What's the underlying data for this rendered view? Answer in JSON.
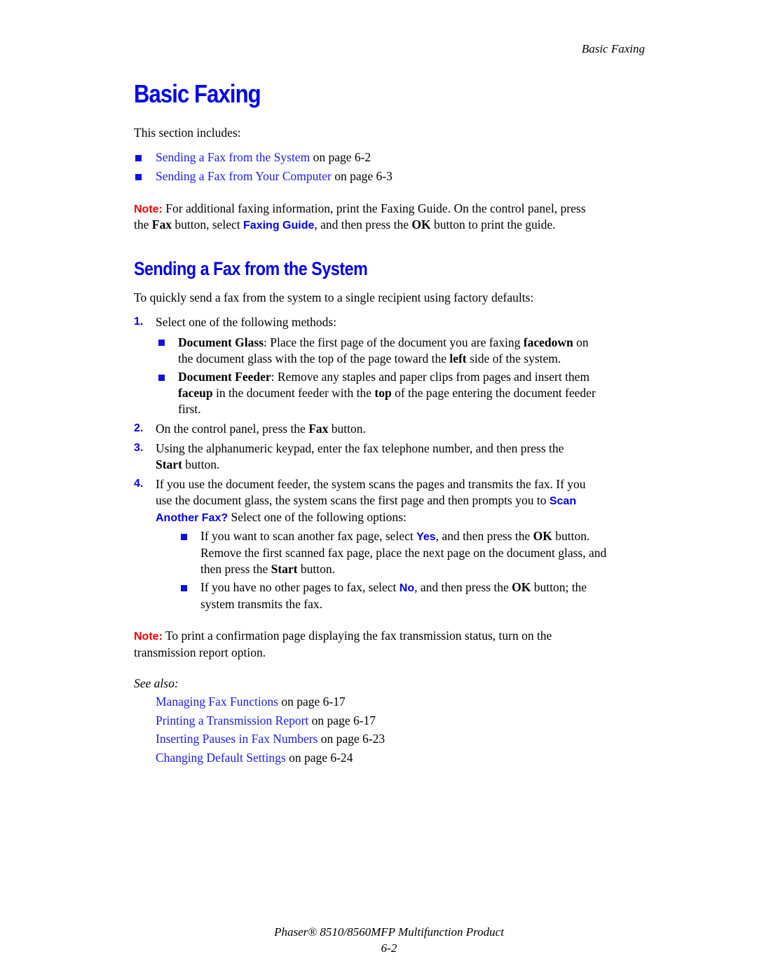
{
  "header": {
    "running_title": "Basic Faxing"
  },
  "title": "Basic Faxing",
  "intro": "This section includes:",
  "toc": [
    {
      "link": "Sending a Fax from the System",
      "suffix": " on page 6-2"
    },
    {
      "link": "Sending a Fax from Your Computer",
      "suffix": " on page 6-3"
    }
  ],
  "note1": {
    "label": "Note:",
    "t1": " For additional faxing information, print the Faxing Guide. On the control panel, press",
    "t2": "the ",
    "b1": "Fax",
    "t3": " button, select ",
    "ui1": "Faxing Guide",
    "t4": ", and then press the ",
    "b2": "OK",
    "t5": " button to print the guide."
  },
  "section": {
    "heading": "Sending a Fax from the System",
    "lead": "To quickly send a fax from the system to a single recipient using factory defaults:",
    "steps": [
      {
        "n": "1.",
        "text": "Select one of the following methods:"
      },
      {
        "n": "2.",
        "pre": "On the control panel, press the ",
        "bold": "Fax",
        "post": " button."
      },
      {
        "n": "3.",
        "line1": "Using the alphanumeric keypad, enter the fax telephone number, and then press the",
        "bold": "Start",
        "post": " button."
      },
      {
        "n": "4.",
        "line1": "If you use the document feeder, the system scans the pages and transmits the fax. If you",
        "line2": "use the document glass, the system scans the first page and then prompts you to ",
        "ui_a": "Scan",
        "ui_b": "Another Fax?",
        "post": " Select one of the following options:"
      }
    ],
    "methods": [
      {
        "bold": "Document Glass",
        "l1": ": Place the first page of the document you are faxing ",
        "b2": "facedown",
        "l1b": " on",
        "l2a": "the document glass with the top of the page toward the ",
        "b3": "left",
        "l2b": " side of the system."
      },
      {
        "bold": "Document Feeder",
        "l1": ": Remove any staples and paper clips from pages and insert them",
        "b2": "faceup",
        "l2a": " in the document feeder with the ",
        "b3": "top",
        "l2b": " of the page entering the document feeder",
        "l3": "first."
      }
    ],
    "options": [
      {
        "l1a": "If you want to scan another fax page, select ",
        "ui": "Yes",
        "l1b": ", and then press the ",
        "b": "OK",
        "l1c": " button.",
        "l2": "Remove the first scanned fax page, place the next page on the document glass, and",
        "l3a": "then press the ",
        "b2": "Start",
        "l3b": " button."
      },
      {
        "l1a": "If you have no other pages to fax, select ",
        "ui": "No",
        "l1b": ", and then press the ",
        "b": "OK",
        "l1c": " button; the",
        "l2": "system transmits the fax."
      }
    ]
  },
  "note2": {
    "label": "Note:",
    "t1": " To print a confirmation page displaying the fax transmission status, turn on the",
    "t2": "transmission report option."
  },
  "see_also": {
    "label": "See also:",
    "items": [
      {
        "link": "Managing Fax Functions",
        "suffix": " on page 6-17"
      },
      {
        "link": "Printing a Transmission Report",
        "suffix": " on page 6-17"
      },
      {
        "link": "Inserting Pauses in Fax Numbers",
        "suffix": " on page 6-23"
      },
      {
        "link": "Changing Default Settings",
        "suffix": " on page 6-24"
      }
    ]
  },
  "footer": {
    "product": "Phaser® 8510/8560MFP Multifunction Product",
    "page": "6-2"
  },
  "colors": {
    "heading": "#0000ee",
    "link": "#1a1aff",
    "note": "#ff0000"
  }
}
